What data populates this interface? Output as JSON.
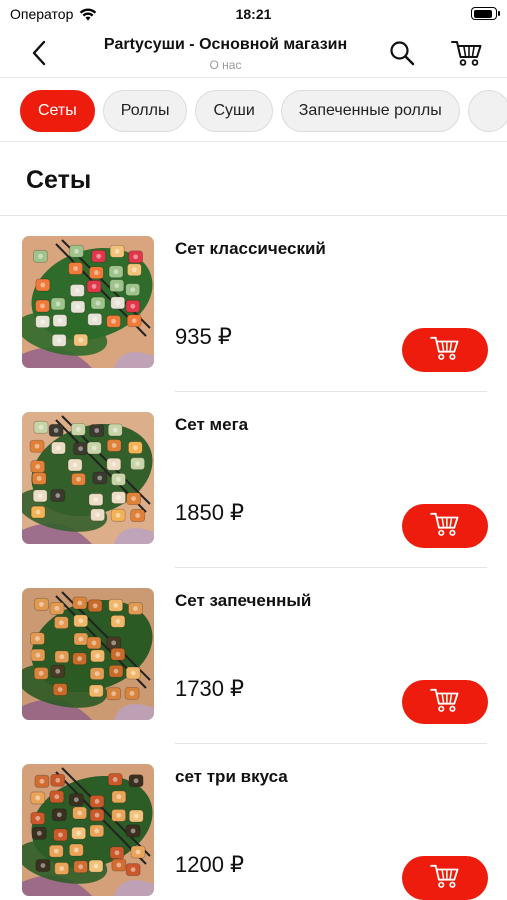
{
  "status_bar": {
    "carrier": "Оператор",
    "time": "18:21",
    "battery_level": 0.9
  },
  "nav": {
    "title": "Partyсуши - Основной магазин",
    "subtitle": "О нас",
    "icons": {
      "back": "chevron-left-icon",
      "search": "search-icon",
      "cart": "cart-icon"
    }
  },
  "categories": [
    {
      "label": "Сеты",
      "active": true
    },
    {
      "label": "Роллы",
      "active": false
    },
    {
      "label": "Суши",
      "active": false
    },
    {
      "label": "Запеченные роллы",
      "active": false
    },
    {
      "label": "",
      "active": false
    }
  ],
  "section": {
    "title": "Сеты"
  },
  "products": [
    {
      "name": "Сет классический",
      "price": "935 ₽"
    },
    {
      "name": "Сет мега",
      "price": "1850 ₽"
    },
    {
      "name": "Сет запеченный",
      "price": "1730 ₽"
    },
    {
      "name": "сет три вкуса",
      "price": "1200 ₽"
    }
  ],
  "colors": {
    "accent": "#ee1c0c",
    "divider": "#e4e4e4",
    "chip_bg": "#f1f1f1",
    "subtitle": "#9a9a9a"
  }
}
